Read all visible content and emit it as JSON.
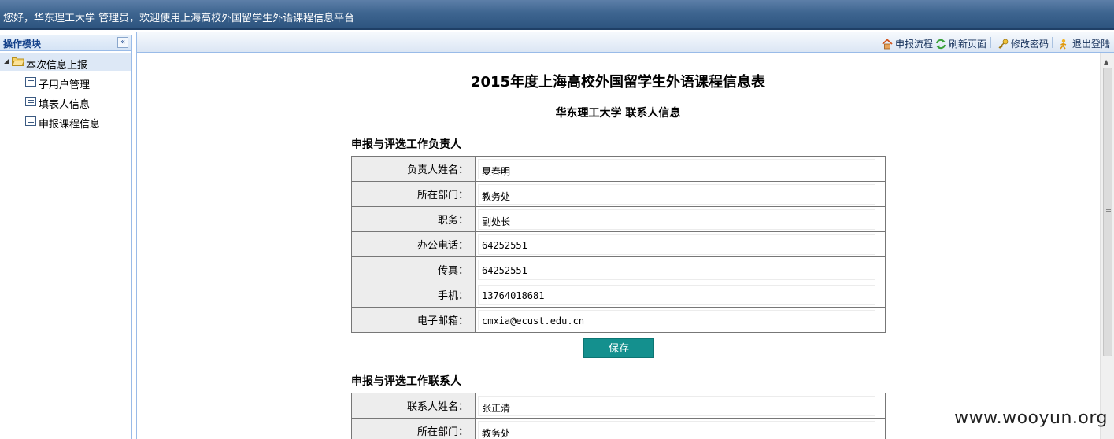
{
  "banner": {
    "welcome": "您好，华东理工大学 管理员，欢迎使用上海高校外国留学生外语课程信息平台"
  },
  "sidebar": {
    "title": "操作模块",
    "collapse_icon": "«",
    "root": {
      "label": "本次信息上报",
      "expanded": true
    },
    "items": [
      {
        "label": "子用户管理"
      },
      {
        "label": "填表人信息"
      },
      {
        "label": "申报课程信息"
      }
    ]
  },
  "toolbar": {
    "items": [
      {
        "label": "申报流程",
        "icon": "home-icon"
      },
      {
        "label": "刷新页面",
        "icon": "refresh-icon"
      },
      {
        "label": "修改密码",
        "icon": "key-icon"
      },
      {
        "label": "退出登陆",
        "icon": "logout-icon"
      }
    ]
  },
  "form": {
    "title": "2015年度上海高校外国留学生外语课程信息表",
    "subtitle": "华东理工大学 联系人信息",
    "section1": {
      "title": "申报与评选工作负责人",
      "rows": [
        {
          "label": "负责人姓名：",
          "value": "夏春明"
        },
        {
          "label": "所在部门：",
          "value": "教务处"
        },
        {
          "label": "职务：",
          "value": "副处长"
        },
        {
          "label": "办公电话：",
          "value": "64252551"
        },
        {
          "label": "传真：",
          "value": "64252551"
        },
        {
          "label": "手机：",
          "value": "13764018681"
        },
        {
          "label": "电子邮箱：",
          "value": "cmxia@ecust.edu.cn"
        }
      ],
      "save_label": "保存"
    },
    "section2": {
      "title": "申报与评选工作联系人",
      "rows": [
        {
          "label": "联系人姓名：",
          "value": "张正清"
        },
        {
          "label": "所在部门：",
          "value": "教务处"
        }
      ]
    }
  },
  "watermark": "www.wooyun.org",
  "colors": {
    "banner": "#3e6590",
    "accent": "#14908e",
    "nav_text": "#15428b"
  }
}
